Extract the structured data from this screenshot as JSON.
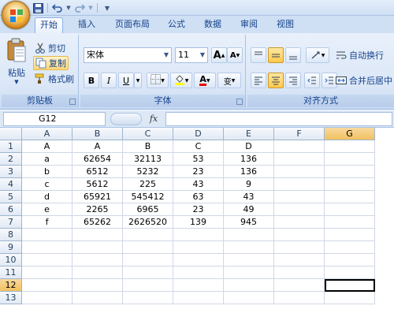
{
  "quick_access": [
    "save-icon",
    "undo-icon",
    "redo-icon",
    "customize-icon"
  ],
  "tabs": [
    "开始",
    "插入",
    "页面布局",
    "公式",
    "数据",
    "审阅",
    "视图"
  ],
  "clipboard": {
    "paste": "粘贴",
    "cut": "剪切",
    "copy": "复制",
    "format_painter": "格式刷",
    "group_label": "剪贴板"
  },
  "font": {
    "name": "宋体",
    "size": "11",
    "grow": "A",
    "shrink": "A",
    "bold": "B",
    "italic": "I",
    "underline": "U",
    "font_color": "A",
    "phonetic": "变",
    "group_label": "字体"
  },
  "alignment": {
    "wrap_text": "自动换行",
    "merge_center": "合并后居中",
    "group_label": "对齐方式"
  },
  "formula_bar": {
    "cell_ref": "G12",
    "fx": "fx",
    "value": ""
  },
  "sheet": {
    "columns": [
      "A",
      "B",
      "C",
      "D",
      "E",
      "F",
      "G"
    ],
    "rows": [
      "1",
      "2",
      "3",
      "4",
      "5",
      "6",
      "7",
      "8",
      "9",
      "10",
      "11",
      "12",
      "13"
    ],
    "active_cell": "G12",
    "cells": [
      [
        "A",
        "A",
        "B",
        "C",
        "D",
        "",
        ""
      ],
      [
        "a",
        "62654",
        "32113",
        "53",
        "136",
        "",
        ""
      ],
      [
        "b",
        "6512",
        "5232",
        "23",
        "136",
        "",
        ""
      ],
      [
        "c",
        "5612",
        "225",
        "43",
        "9",
        "",
        ""
      ],
      [
        "d",
        "65921",
        "545412",
        "63",
        "43",
        "",
        ""
      ],
      [
        "e",
        "2265",
        "6965",
        "23",
        "49",
        "",
        ""
      ],
      [
        "f",
        "65262",
        "2626520",
        "139",
        "945",
        "",
        ""
      ],
      [
        "",
        "",
        "",
        "",
        "",
        "",
        ""
      ],
      [
        "",
        "",
        "",
        "",
        "",
        "",
        ""
      ],
      [
        "",
        "",
        "",
        "",
        "",
        "",
        ""
      ],
      [
        "",
        "",
        "",
        "",
        "",
        "",
        ""
      ],
      [
        "",
        "",
        "",
        "",
        "",
        "",
        ""
      ],
      [
        "",
        "",
        "",
        "",
        "",
        "",
        ""
      ]
    ]
  },
  "colors": {
    "ribbon": "#dbe7f7",
    "selected_header": "#f1c15f",
    "grid_line": "#d0d7e5"
  }
}
